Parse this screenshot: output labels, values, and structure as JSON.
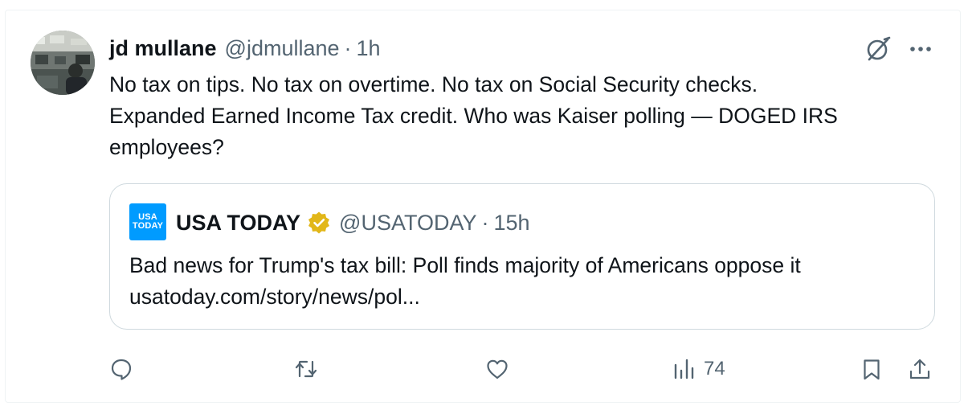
{
  "post": {
    "author_name": "jd mullane",
    "handle": "@jdmullane",
    "separator": "·",
    "time": "1h",
    "text_lines": [
      "No tax on tips. No tax on overtime. No tax on Social Security checks.",
      "Expanded Earned Income Tax credit. Who was Kaiser polling — DOGED IRS",
      "employees?"
    ]
  },
  "quoted": {
    "logo_line1": "USA",
    "logo_line2": "TODAY",
    "author_name": "USA TODAY",
    "handle": "@USATODAY",
    "separator": "·",
    "time": "15h",
    "text_lines": [
      "Bad news for Trump's tax bill: Poll finds majority of Americans oppose it",
      "usatoday.com/story/news/pol..."
    ]
  },
  "actions": {
    "views_count": "74"
  },
  "icons": {
    "header": [
      "grok-icon",
      "more-icon"
    ],
    "footer": [
      "reply-icon",
      "repost-icon",
      "like-icon",
      "views-icon",
      "bookmark-icon",
      "share-icon"
    ]
  },
  "colors": {
    "text_primary": "#0f1419",
    "text_secondary": "#536471",
    "border": "#cfd9de",
    "usa_today_blue": "#009bff",
    "verified_gold": "#e2b719"
  }
}
